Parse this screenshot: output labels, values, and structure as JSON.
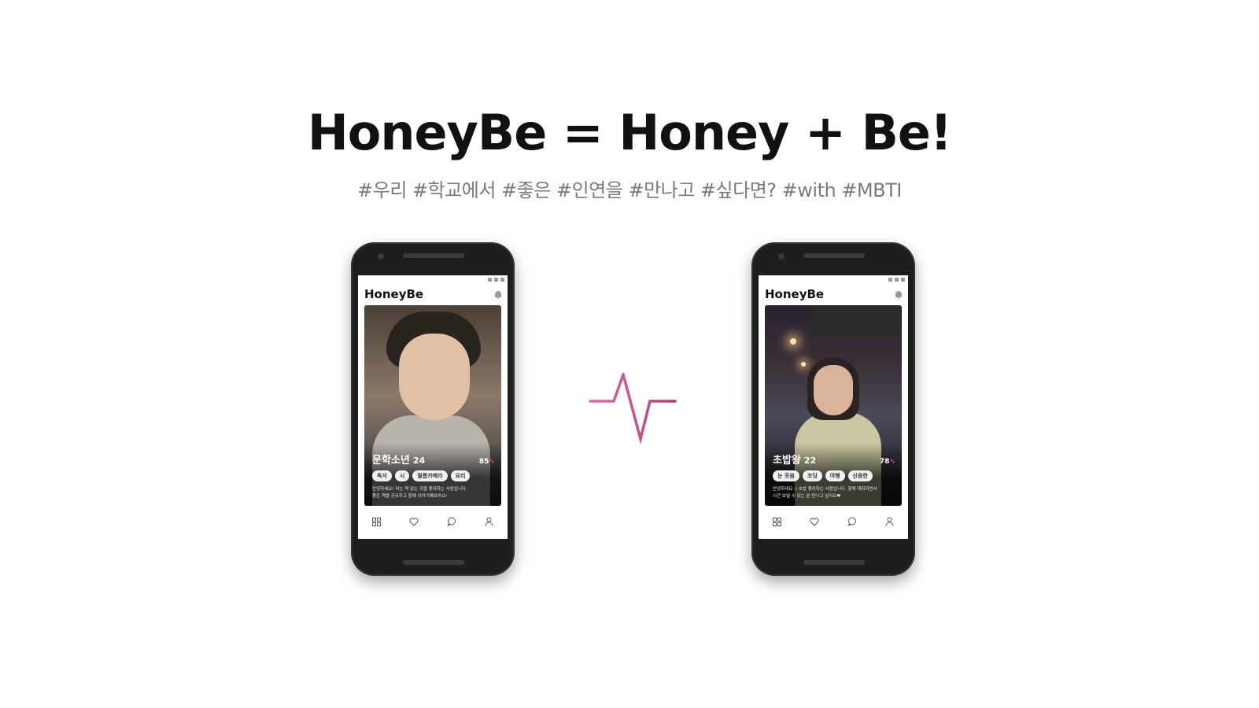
{
  "slide": {
    "title": "HoneyBe = Honey + Be!",
    "subtitle": "#우리 #학교에서 #좋은 #인연을 #만나고 #싶다면? #with #MBTI"
  },
  "colors": {
    "accent": "#d04a86",
    "pulse_start": "#e36aa8",
    "pulse_end": "#b33a78"
  },
  "icons": [
    "bell-icon",
    "grid-icon",
    "heart-icon",
    "chat-icon",
    "profile-icon",
    "pulse-icon"
  ],
  "phones": [
    {
      "app_name": "HoneyBe",
      "profile": {
        "name": "문학소년",
        "age": "24",
        "heart": "♡",
        "score": "85",
        "tags": [
          "독서",
          "시",
          "필름카메라",
          "요리"
        ],
        "bio_line1": "안녕하세요! 저는 책 읽는 것을 좋아하는 사람입니다.",
        "bio_line2": "좋은 책을 공유하고 함께 이야기해보아요!"
      }
    },
    {
      "app_name": "HoneyBe",
      "profile": {
        "name": "초밥왕",
        "age": "22",
        "heart": "♡",
        "score": "78",
        "tags": [
          "눈 웃음",
          "코딩",
          "여행",
          "신중한"
        ],
        "bio_line1": "안녕하세요 :) 초밥 좋아하는 사람입니다. 함께 대화하면서",
        "bio_line2": "시간 보낼 수 있는 분 만나고 싶어요♥"
      }
    }
  ]
}
